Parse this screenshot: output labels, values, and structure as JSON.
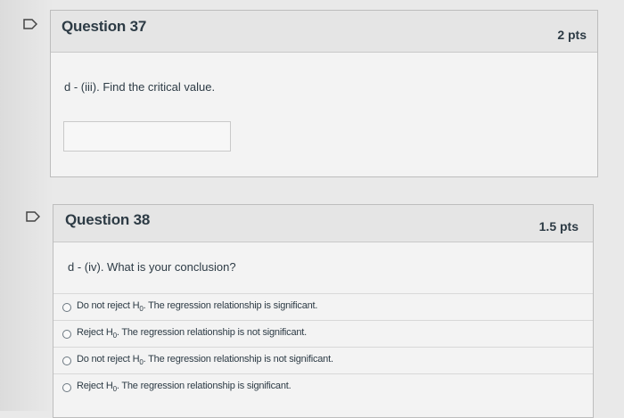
{
  "questions": [
    {
      "title": "Question 37",
      "points": "2 pts",
      "prompt": "d - (iii). Find the critical value."
    },
    {
      "title": "Question 38",
      "points": "1.5 pts",
      "prompt": "d - (iv). What is your conclusion?",
      "options": [
        {
          "pre": "Do not reject H",
          "sub": "0",
          "post": ". The regression relationship is significant."
        },
        {
          "pre": "Reject H",
          "sub": "0",
          "post": ". The regression relationship is not significant."
        },
        {
          "pre": "Do not reject H",
          "sub": "0",
          "post": ". The regression relationship is not significant."
        },
        {
          "pre": "Reject H",
          "sub": "0",
          "post": ". The regression relationship is significant."
        }
      ]
    }
  ],
  "icons": {
    "flag": "flag-icon",
    "radio": "radio-button-icon"
  }
}
